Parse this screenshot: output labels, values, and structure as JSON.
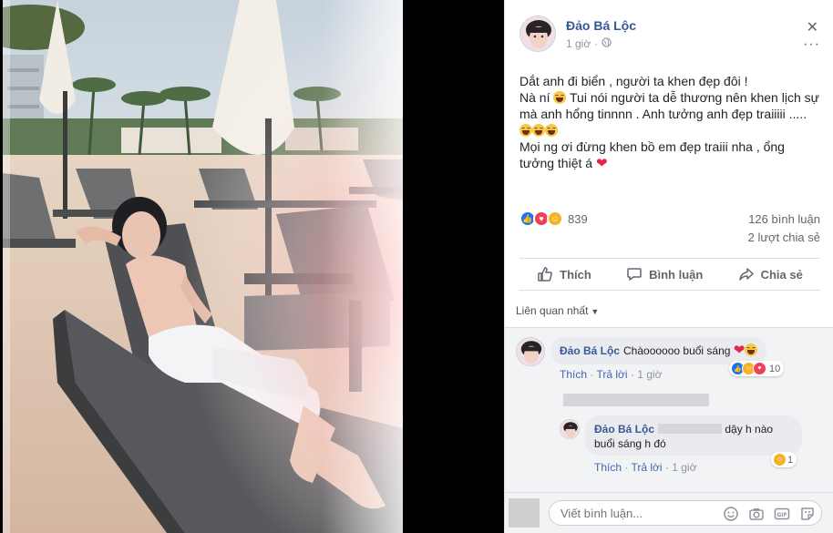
{
  "post": {
    "author": "Đảo Bá Lộc",
    "time": "1 giờ",
    "lines": [
      "Dắt anh đi biển , người ta khen đẹp đôi !",
      "Nà ní",
      "Tui nói người ta dễ thương nên khen lịch sự mà anh hổng tinnnn . Anh tưởng anh đẹp traiiiii .....",
      "Mọi ng ơi đừng khen bồ em đẹp traiii nha , ổng tưởng thiệt á"
    ],
    "reaction_count": "839",
    "comment_count": "126 bình luận",
    "share_count": "2 lượt chia sẻ",
    "actions": {
      "like": "Thích",
      "comment": "Bình luận",
      "share": "Chia sẻ"
    },
    "sort_label": "Liên quan nhất"
  },
  "comments": [
    {
      "author": "Đảo Bá Lộc",
      "text": "Chàoooooo buổi sáng",
      "like": "Thích",
      "reply": "Trả lời",
      "time": "1 giờ",
      "reactions": "10"
    },
    {
      "author": "Đảo Bá Lộc",
      "text_a": "dậy h nào",
      "text_b": "buổi sáng h đó",
      "like": "Thích",
      "reply": "Trả lời",
      "time": "1 giờ",
      "reactions": "1"
    }
  ],
  "composer": {
    "placeholder": "Viết bình luận..."
  },
  "colors": {
    "link": "#365899",
    "accent": "#4267b2",
    "love": "#e2264d"
  }
}
